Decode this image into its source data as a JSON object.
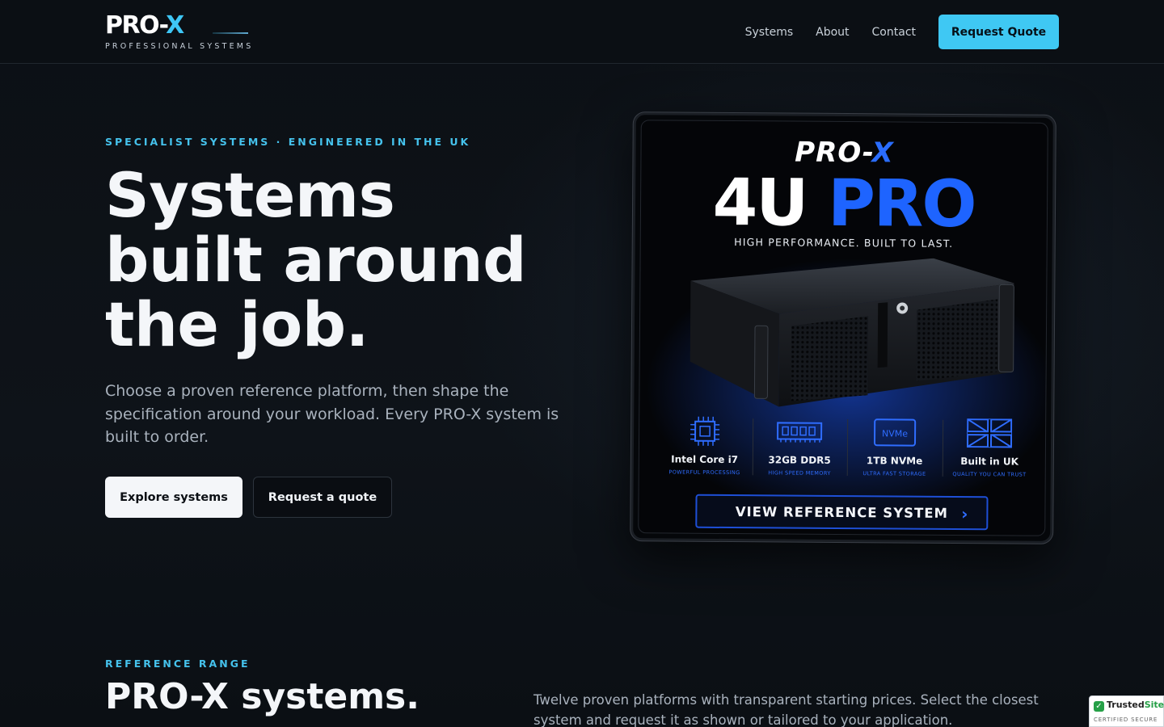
{
  "brand": {
    "name_main": "PRO-",
    "name_accent": "X",
    "tagline": "PROFESSIONAL SYSTEMS"
  },
  "nav": {
    "links": [
      "Systems",
      "About",
      "Contact"
    ],
    "cta": "Request Quote"
  },
  "hero": {
    "eyebrow": "SPECIALIST SYSTEMS · ENGINEERED IN THE UK",
    "title_lines": [
      "Systems",
      "built around",
      "the job."
    ],
    "description": "Choose a proven reference platform, then shape the specification around your workload. Every PRO-X system is built to order.",
    "primary_button": "Explore systems",
    "secondary_button": "Request a quote"
  },
  "promo": {
    "brand_main": "PRO-",
    "brand_accent": "X",
    "model_white": "4U",
    "model_blue": "PRO",
    "tagline": "HIGH PERFORMANCE. BUILT TO LAST.",
    "specs": [
      {
        "icon": "cpu-icon",
        "label": "Intel Core i7",
        "sub": "POWERFUL PROCESSING"
      },
      {
        "icon": "memory-icon",
        "label": "32GB DDR5",
        "sub": "HIGH SPEED MEMORY"
      },
      {
        "icon": "nvme-icon",
        "label": "1TB NVMe",
        "sub": "ULTRA FAST STORAGE",
        "badge": "NVMe"
      },
      {
        "icon": "uk-flag-icon",
        "label": "Built in UK",
        "sub": "QUALITY YOU CAN TRUST"
      }
    ],
    "cta": "VIEW REFERENCE SYSTEM"
  },
  "range": {
    "eyebrow": "REFERENCE RANGE",
    "title": "PRO-X systems.",
    "description": "Twelve proven platforms with transparent starting prices. Select the closest system and request it as shown or tailored to your application."
  },
  "trust_badge": {
    "name_main": "Trusted",
    "name_accent": "Site",
    "sub": "CERTIFIED SECURE"
  },
  "colors": {
    "background": "#0d1117",
    "accent": "#3fc8f3",
    "promo_blue": "#1e64ff",
    "text": "#f4f6f9",
    "muted": "#a9b2bd"
  }
}
